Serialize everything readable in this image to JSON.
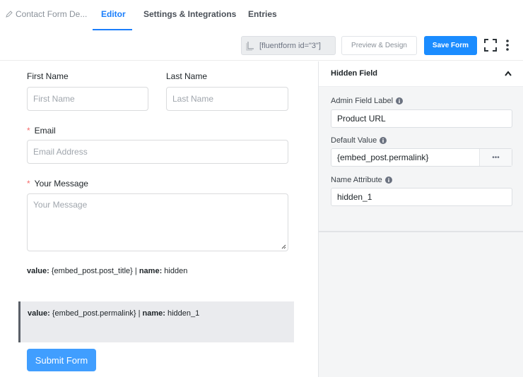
{
  "nav": {
    "breadcrumb": "Contact Form De...",
    "tabs": [
      {
        "label": "Editor",
        "active": true
      },
      {
        "label": "Settings & Integrations",
        "active": false
      },
      {
        "label": "Entries",
        "active": false
      }
    ]
  },
  "toolbar": {
    "shortcode": "[fluentform id=\"3\"]",
    "preview_label": "Preview & Design",
    "save_label": "Save Form",
    "icons": [
      "copy-icon",
      "fullscreen-icon",
      "kebab-icon"
    ]
  },
  "form": {
    "first_name": {
      "label": "First Name",
      "placeholder": "First Name"
    },
    "last_name": {
      "label": "Last Name",
      "placeholder": "Last Name"
    },
    "email": {
      "required_mark": "*",
      "label": "Email",
      "placeholder": "Email Address"
    },
    "message": {
      "required_mark": "*",
      "label": "Your Message",
      "placeholder": "Your Message"
    },
    "hidden_1": {
      "value_key": "value:",
      "value": "{embed_post.post_title}",
      "sep": "|",
      "name_key": "name:",
      "name": "hidden"
    },
    "hidden_2": {
      "value_key": "value:",
      "value": "{embed_post.permalink}",
      "sep": "|",
      "name_key": "name:",
      "name": "hidden_1"
    },
    "submit_label": "Submit Form"
  },
  "panel": {
    "title": "Hidden Field",
    "admin_label": {
      "label": "Admin Field Label",
      "value": "Product URL"
    },
    "default_value": {
      "label": "Default Value",
      "value": "{embed_post.permalink}",
      "more": "•••"
    },
    "name_attr": {
      "label": "Name Attribute",
      "value": "hidden_1"
    }
  },
  "colors": {
    "accent": "#1a7efb",
    "save_button": "#1a8cff",
    "submit_button": "#409eff",
    "required": "#f56c6c"
  }
}
